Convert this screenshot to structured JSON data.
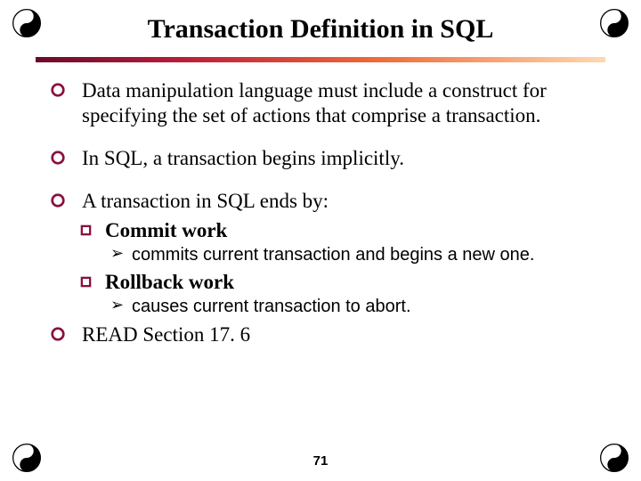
{
  "title": "Transaction Definition in SQL",
  "bullets": {
    "b1": "Data manipulation language must include a construct for specifying the set of actions that comprise a transaction.",
    "b2": "In SQL, a transaction begins implicitly.",
    "b3": "A transaction in SQL ends by:",
    "b3_sub1": "Commit work",
    "b3_sub1_detail": "commits current transaction and begins a new one.",
    "b3_sub2": "Rollback work",
    "b3_sub2_detail": "causes current transaction to abort.",
    "b4": "READ Section 17. 6"
  },
  "page_number": "71",
  "glyphs": {
    "arrow": "➢"
  }
}
